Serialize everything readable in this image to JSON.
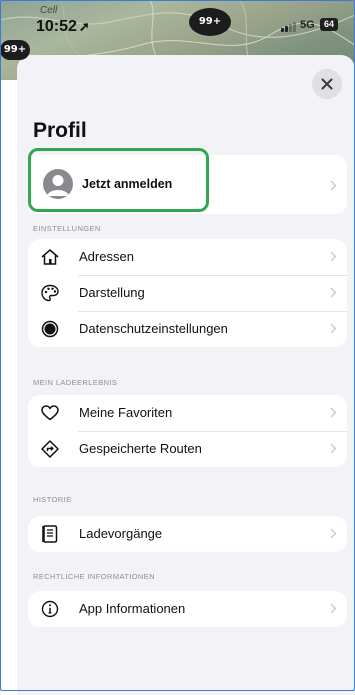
{
  "status_bar": {
    "time": "10:52",
    "network": "5G",
    "battery": "64",
    "badge_top": "99+",
    "badge_left": "99+"
  },
  "map": {
    "label": "Cell"
  },
  "sheet": {
    "title": "Profil",
    "login_label": "Jetzt anmelden",
    "sections": [
      {
        "header": "EINSTELLUNGEN",
        "items": [
          {
            "label": "Adressen",
            "icon": "house-icon"
          },
          {
            "label": "Darstellung",
            "icon": "palette-icon"
          },
          {
            "label": "Datenschutzeinstellungen",
            "icon": "privacy-toggle-icon"
          }
        ]
      },
      {
        "header": "MEIN LADEERLEBNIS",
        "items": [
          {
            "label": "Meine Favoriten",
            "icon": "heart-icon"
          },
          {
            "label": "Gespeicherte Routen",
            "icon": "route-icon"
          }
        ]
      },
      {
        "header": "HISTORIE",
        "items": [
          {
            "label": "Ladevorgänge",
            "icon": "list-document-icon"
          }
        ]
      },
      {
        "header": "RECHTLICHE INFORMATIONEN",
        "items": [
          {
            "label": "App Informationen",
            "icon": "info-icon"
          }
        ]
      }
    ]
  },
  "colors": {
    "highlight": "#2fa84f",
    "sheet_bg": "#f2f2f7"
  }
}
